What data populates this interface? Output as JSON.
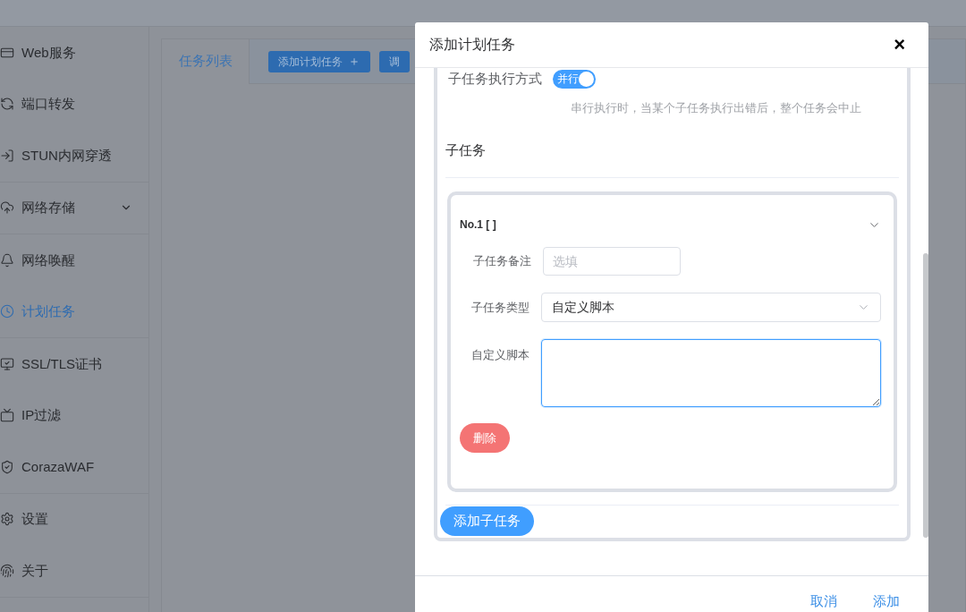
{
  "sidebar": {
    "groups": [
      {
        "items": [
          {
            "label": "Web服务",
            "selected": false
          },
          {
            "label": "端口转发",
            "selected": false
          },
          {
            "label": "STUN内网穿透",
            "selected": false
          }
        ]
      },
      {
        "items": [
          {
            "label": "网络存储",
            "selected": false,
            "expanded": false
          }
        ]
      },
      {
        "items": [
          {
            "label": "网络唤醒",
            "selected": false
          },
          {
            "label": "计划任务",
            "selected": true
          }
        ]
      },
      {
        "items": [
          {
            "label": "SSL/TLS证书",
            "selected": false
          },
          {
            "label": "IP过滤",
            "selected": false
          },
          {
            "label": "CorazaWAF",
            "selected": false
          }
        ]
      },
      {
        "items": [
          {
            "label": "设置",
            "selected": false
          },
          {
            "label": "关于",
            "selected": false
          }
        ]
      }
    ]
  },
  "main": {
    "tabs": [
      {
        "label": "任务列表",
        "selected": true
      }
    ],
    "buttons": [
      {
        "label": "添加计划任务",
        "icon": "＋"
      },
      {
        "label": "调"
      }
    ]
  },
  "dialog": {
    "title": "添加计划任务",
    "close": "×",
    "mode": {
      "label": "子任务执行方式",
      "on": true,
      "text": "并行",
      "hint": "串行执行时，当某个子任务执行出错后，整个任务会中止"
    },
    "section_title": "子任务",
    "subtasks": [
      {
        "title": "No.1 [ ]",
        "expanded": true,
        "fields": [
          {
            "kind": "input",
            "label": "子任务备注",
            "placeholder": "选填"
          },
          {
            "kind": "select",
            "label": "子任务类型",
            "value": "自定义脚本"
          },
          {
            "kind": "textarea",
            "label": "自定义脚本",
            "focused": true
          }
        ],
        "delete": "删除"
      }
    ],
    "add_subtask": "添加子任务",
    "footer": {
      "cancel": "取消",
      "confirm": "添加"
    }
  }
}
